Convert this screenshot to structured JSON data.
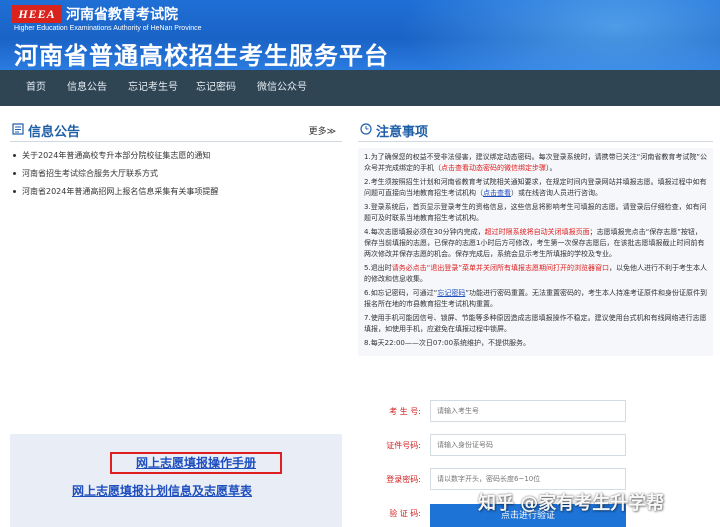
{
  "header": {
    "logo_mark": "HEEA",
    "institution": "河南省教育考试院",
    "institution_en": "Higher Education Examinations Authority of HeNan Province",
    "platform_title": "河南省普通高校招生考生服务平台"
  },
  "nav": {
    "items": [
      "首页",
      "信息公告",
      "忘记考生号",
      "忘记密码",
      "微信公众号"
    ]
  },
  "announcements": {
    "title": "信息公告",
    "more": "更多≫",
    "items": [
      "关于2024年普通高校专升本部分院校征集志愿的通知",
      "河南省招生考试综合服务大厅联系方式",
      "河南省2024年普通高招网上报名信息采集有关事项提醒"
    ]
  },
  "manual": {
    "operation_manual": "网上志愿填报操作手册",
    "plan_info": "网上志愿填报计划信息及志愿草表"
  },
  "notice": {
    "title": "注意事项",
    "items": [
      {
        "num": "1.",
        "a": "为了确保您的权益不受非法侵害，建议绑定动态密码。每次登录系统时，请携带已关注“河南省教育考试院”公众号并完成绑定的手机（",
        "red": "点击查看动态密码的微信绑定步骤",
        "b": "）。"
      },
      {
        "num": "2.",
        "a": "考生须按照招生计划和河南省教育考试院相关通知要求，在规定时间内登录网站并填报志愿。填报过程中如有问题可直接向当地教育招生考试机构（",
        "blue": "点击查看",
        "b": "）或在线咨询人员进行咨询。"
      },
      {
        "num": "3.",
        "a": "登录系统后，首页显示登录考生的资格信息，这些信息将影响考生可填报的志愿。请登录后仔细检查，如有问题可及时联系当地教育招生考试机构。"
      },
      {
        "num": "4.",
        "a": "每次志愿填报必须在30分钟内完成，",
        "red": "超过时限系统将自动关闭填报页面",
        "b": "；志愿填报完点击“保存志愿”按钮，保存当前填报的志愿，已保存的志愿1小时后方可修改，考生第一次保存志愿后，在该批志愿填报截止时间前有两次修改并保存志愿的机会。保存完成后，系统会显示考生所填报的学校及专业。"
      },
      {
        "num": "5.",
        "a": "退出时",
        "red": "请务必点击“退出登录”菜单并关闭所有填报志愿期间打开的浏览器窗口",
        "b": "，以免他人进行不利于考生本人的修改和信息收集。"
      },
      {
        "num": "6.",
        "a": "如忘记密码，可通过“",
        "blue": "忘记密码",
        "b": "”功能进行密码重置。无法重置密码的，考生本人持准考证原件和身份证原件到报名所在地的市县教育招生考试机构重置。"
      },
      {
        "num": "7.",
        "a": "使用手机可能因信号、锁屏、节能等多种原因造成志愿填报操作不稳定。建议使用台式机和有线网络进行志愿填报，如使用手机，应避免在填报过程中锁屏。"
      },
      {
        "num": "8.",
        "a": "每天22:00——次日07:00系统维护，不提供服务。"
      }
    ]
  },
  "form": {
    "candidate_label": "考 生 号:",
    "candidate_placeholder": "请输入考生号",
    "id_label": "证件号码:",
    "id_placeholder": "请输入身份证号码",
    "password_label": "登录密码:",
    "password_placeholder": "请以数字开头，密码长度6~10位",
    "captcha_label": "验 证 码:",
    "verify_button": "点击进行验证"
  },
  "watermark": "知乎 @家有考生升学帮",
  "colors": {
    "header_blue": "#1a63c6",
    "nav_bg": "#2f4554",
    "accent_red": "#e02020",
    "link_blue": "#1f4fbf",
    "button_blue": "#1e73d6"
  }
}
